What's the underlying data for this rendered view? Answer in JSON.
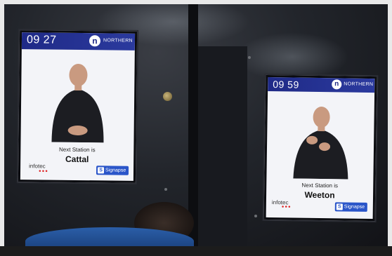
{
  "screens": [
    {
      "time": "09 27",
      "brand": "NORTHERN",
      "brand_logo": "n",
      "next_label": "Next Station is",
      "station": "Cattal",
      "maker": "infotec",
      "sign_brand": "Signapse",
      "sign_icon": "S"
    },
    {
      "time": "09 59",
      "brand": "NORTHERN",
      "brand_logo": "n",
      "next_label": "Next Station is",
      "station": "Weeton",
      "maker": "infotec",
      "sign_brand": "Signapse",
      "sign_icon": "S"
    }
  ],
  "colors": {
    "header": "#1f2a87",
    "signapse": "#2a55c9",
    "seat": "#2b5ea8"
  }
}
